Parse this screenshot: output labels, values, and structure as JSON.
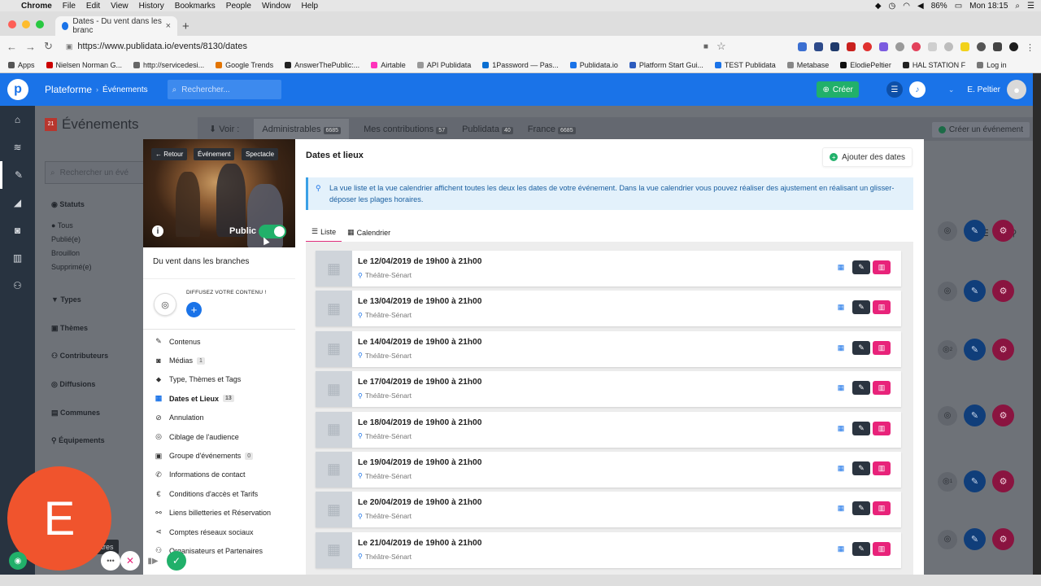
{
  "macos": {
    "app": "Chrome",
    "menus": [
      "File",
      "Edit",
      "View",
      "History",
      "Bookmarks",
      "People",
      "Window",
      "Help"
    ],
    "battery": "86%",
    "clock": "Mon 18:15"
  },
  "browser": {
    "tab_title": "Dates - Du vent dans les branc",
    "url": "https://www.publidata.io/events/8130/dates",
    "bookmarks": [
      "Apps",
      "Nielsen Norman G...",
      "http://servicedesi...",
      "Google Trends",
      "AnswerThePublic:...",
      "Airtable",
      "API Publidata",
      "1Password — Pas...",
      "Publidata.io",
      "Platform Start Gui...",
      "TEST Publidata",
      "Metabase",
      "ElodiePeltier",
      "HAL STATION F",
      "Log in"
    ]
  },
  "topnav": {
    "brand": "Plateforme",
    "section": "Événements",
    "search_placeholder": "Rechercher...",
    "create_label": "Créer",
    "user_name": "E. Peltier"
  },
  "background": {
    "title": "Événements",
    "calendar_day": "21",
    "view_label": "Voir :",
    "tabs": [
      {
        "label": "Administrables",
        "count": "6685"
      },
      {
        "label": "Mes contributions",
        "count": "57"
      },
      {
        "label": "Publidata",
        "count": "40"
      },
      {
        "label": "France",
        "count": "6685"
      }
    ],
    "create_event": "Créer un événement",
    "search_placeholder": "Rechercher un évé",
    "statuts_label": "Statuts",
    "statuts": [
      "Tous",
      "Publié(e)",
      "Brouillon",
      "Supprimé(e)"
    ],
    "filters": [
      "Types",
      "Thèmes",
      "Contributeurs",
      "Diffusions",
      "Communes",
      "Équipements"
    ],
    "filter_tooltip": "les filtres",
    "badges": [
      "2",
      "1"
    ]
  },
  "modal": {
    "back_label": "Retour",
    "chips": [
      "Événement",
      "Spectacle"
    ],
    "public_label": "Public",
    "public_on": true,
    "event_title": "Du vent dans les branches",
    "diffuse_text": "DIFFUSEZ VOTRE CONTENU !",
    "menu": [
      {
        "label": "Contenus",
        "icon": "pencil-icon",
        "glyph": "✎",
        "count": null,
        "active": false
      },
      {
        "label": "Médias",
        "icon": "camera-icon",
        "glyph": "◙",
        "count": "1",
        "active": false
      },
      {
        "label": "Type, Thèmes et Tags",
        "icon": "tag-icon",
        "glyph": "⬥",
        "count": null,
        "active": false
      },
      {
        "label": "Dates et Lieux",
        "icon": "calendar-icon",
        "glyph": "▦",
        "count": "13",
        "active": true
      },
      {
        "label": "Annulation",
        "icon": "ban-icon",
        "glyph": "⊘",
        "count": null,
        "active": false
      },
      {
        "label": "Ciblage de l'audience",
        "icon": "target-icon",
        "glyph": "◎",
        "count": null,
        "active": false
      },
      {
        "label": "Groupe d'événements",
        "icon": "folder-icon",
        "glyph": "▣",
        "count": "0",
        "active": false
      },
      {
        "label": "Informations de contact",
        "icon": "phone-icon",
        "glyph": "✆",
        "count": null,
        "active": false
      },
      {
        "label": "Conditions d'accès et Tarifs",
        "icon": "euro-icon",
        "glyph": "€",
        "count": null,
        "active": false
      },
      {
        "label": "Liens billetteries et Réservation",
        "icon": "link-icon",
        "glyph": "⚯",
        "count": null,
        "active": false
      },
      {
        "label": "Comptes réseaux sociaux",
        "icon": "share-icon",
        "glyph": "⋖",
        "count": null,
        "active": false
      },
      {
        "label": "Organisateurs et Partenaires",
        "icon": "handshake-icon",
        "glyph": "⚇",
        "count": null,
        "active": false
      }
    ],
    "section_title": "Dates et lieux",
    "add_dates_label": "Ajouter des dates",
    "notice": "La vue liste et la vue calendrier affichent toutes les deux les dates de votre événement. Dans la vue calendrier vous pouvez réaliser des ajustement en réalisant un glisser-déposer les plages horaires.",
    "view_tabs": [
      "Liste",
      "Calendrier"
    ],
    "dates": [
      {
        "text": "Le 12/04/2019 de 19h00 à 21h00",
        "place": "Théâtre-Sénart"
      },
      {
        "text": "Le 13/04/2019 de 19h00 à 21h00",
        "place": "Théâtre-Sénart"
      },
      {
        "text": "Le 14/04/2019 de 19h00 à 21h00",
        "place": "Théâtre-Sénart"
      },
      {
        "text": "Le 17/04/2019 de 19h00 à 21h00",
        "place": "Théâtre-Sénart"
      },
      {
        "text": "Le 18/04/2019 de 19h00 à 21h00",
        "place": "Théâtre-Sénart"
      },
      {
        "text": "Le 19/04/2019 de 19h00 à 21h00",
        "place": "Théâtre-Sénart"
      },
      {
        "text": "Le 20/04/2019 de 19h00 à 21h00",
        "place": "Théâtre-Sénart"
      },
      {
        "text": "Le 21/04/2019 de 19h00 à 21h00",
        "place": "Théâtre-Sénart"
      }
    ]
  },
  "overlay": {
    "recorder_letter": "E"
  },
  "colors": {
    "primary": "#1a73e8",
    "success": "#21b06a",
    "danger": "#e8237a",
    "dark": "#2b3440",
    "recorder": "#f0542d"
  }
}
